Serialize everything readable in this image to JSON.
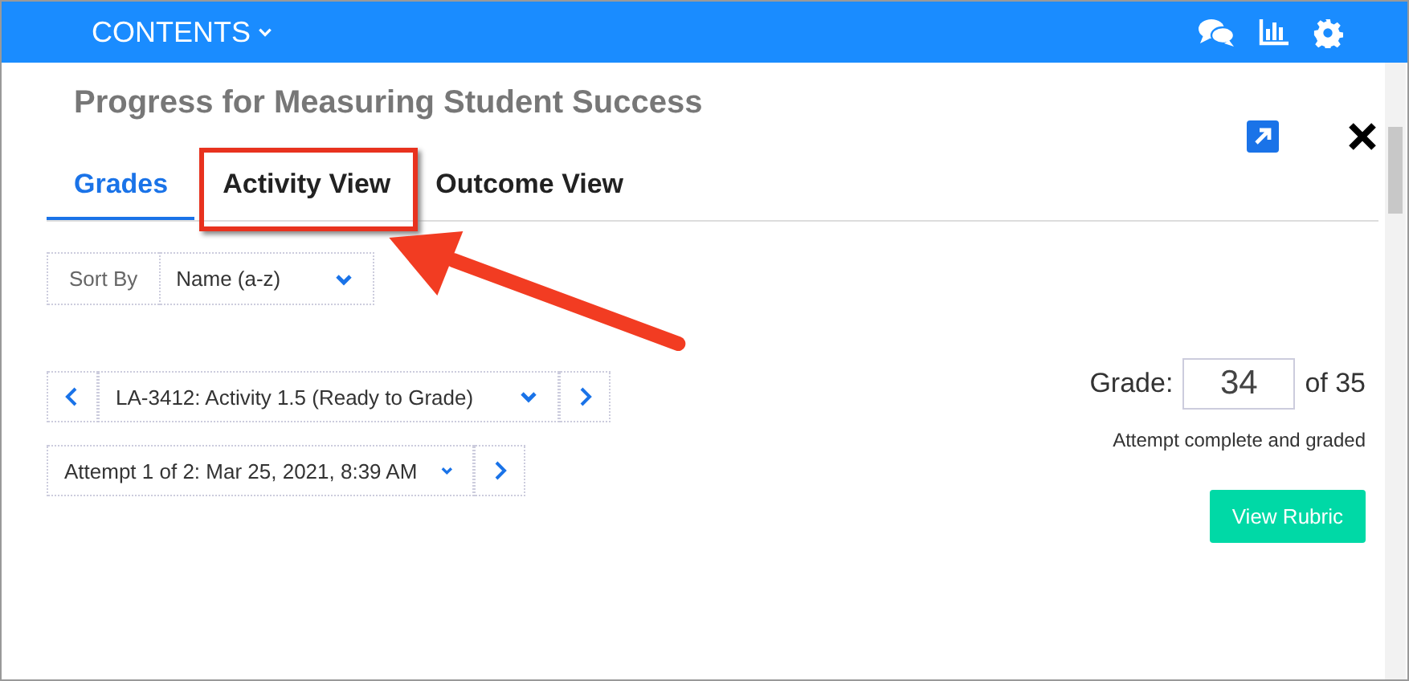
{
  "top_bar": {
    "menu_label": "CONTENTS"
  },
  "panel": {
    "title": "Progress for Measuring Student Success"
  },
  "tabs": [
    {
      "label": "Grades",
      "selected": true,
      "highlighted": false
    },
    {
      "label": "Activity View",
      "selected": false,
      "highlighted": true
    },
    {
      "label": "Outcome View",
      "selected": false,
      "highlighted": false
    }
  ],
  "sort": {
    "label": "Sort By",
    "value": "Name (a-z)"
  },
  "activity_selector": {
    "value": "LA-3412: Activity 1.5 (Ready to Grade)"
  },
  "attempt_selector": {
    "value": "Attempt 1 of 2: Mar 25, 2021, 8:39 AM"
  },
  "grade": {
    "label": "Grade:",
    "value": "34",
    "out_of": "of 35",
    "status": "Attempt complete and graded"
  },
  "buttons": [
    "View Rubric"
  ]
}
